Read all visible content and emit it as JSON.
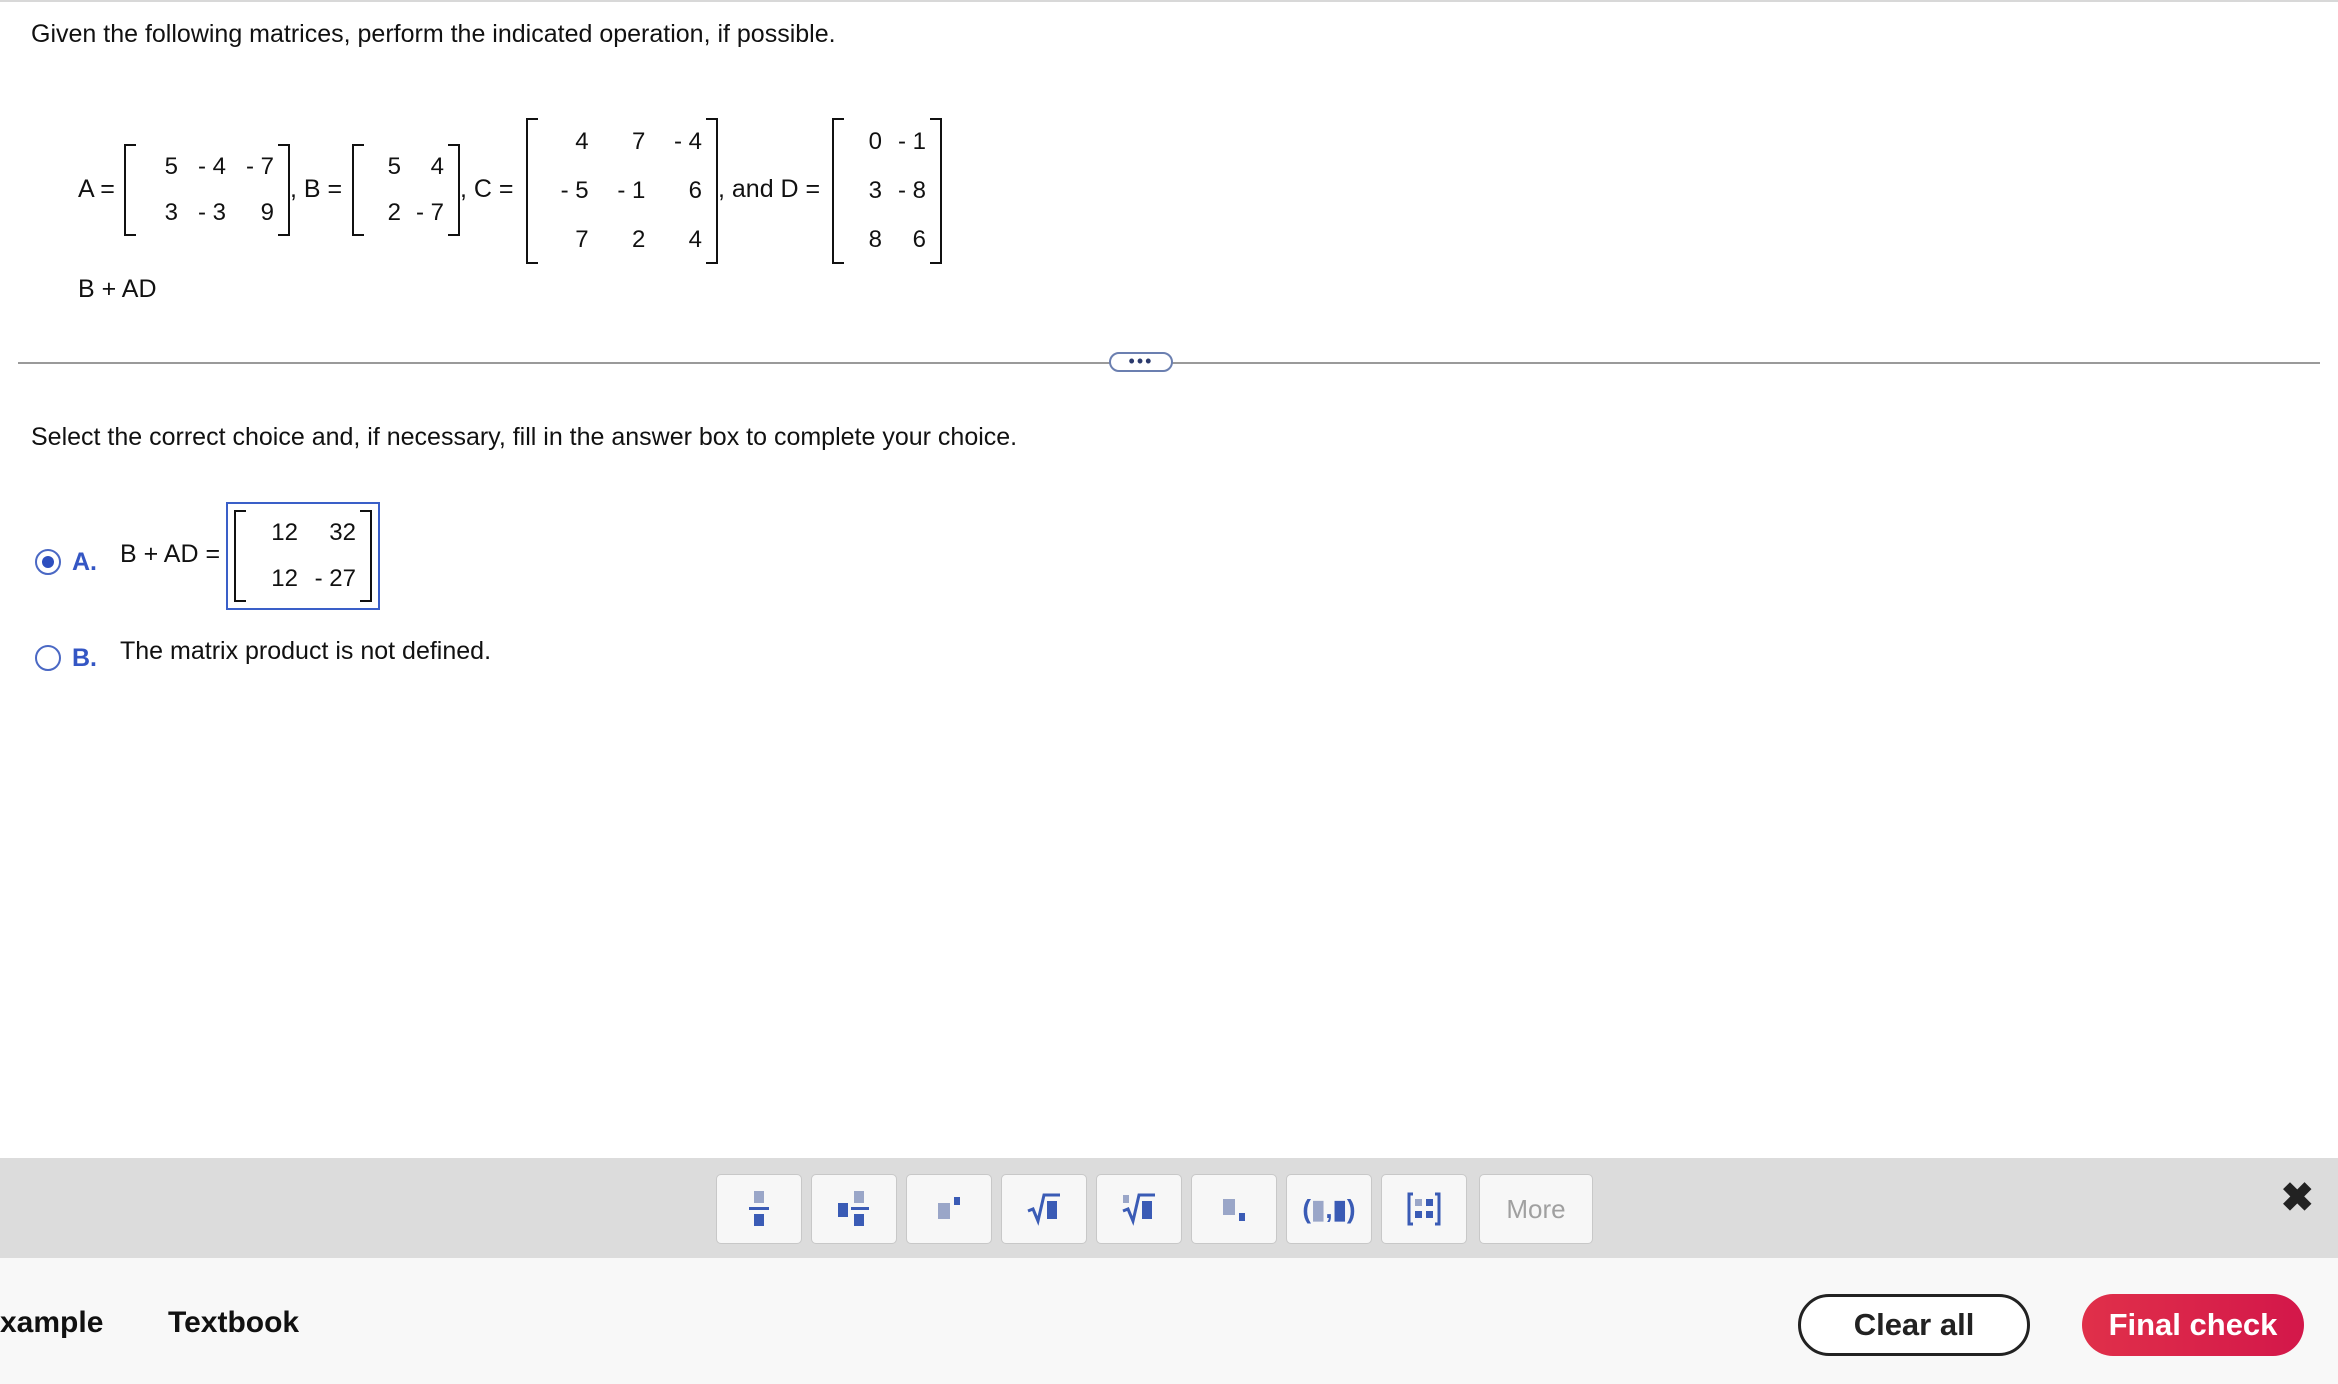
{
  "question": "Given the following matrices, perform the indicated operation, if possible.",
  "labels": {
    "a": "A =",
    "b": ", B =",
    "c": ", C =",
    "d": ", and D ="
  },
  "matrices": {
    "A": [
      [
        "5",
        "- 4",
        "- 7"
      ],
      [
        "3",
        "- 3",
        "9"
      ]
    ],
    "B": [
      [
        "5",
        "4"
      ],
      [
        "2",
        "- 7"
      ]
    ],
    "C": [
      [
        "4",
        "7",
        "- 4"
      ],
      [
        "- 5",
        "- 1",
        "6"
      ],
      [
        "7",
        "2",
        "4"
      ]
    ],
    "D": [
      [
        "0",
        "- 1"
      ],
      [
        "3",
        "- 8"
      ],
      [
        "8",
        "6"
      ]
    ]
  },
  "subtask": "B + AD",
  "instruction": "Select the correct choice and, if necessary, fill in the answer box to complete your choice.",
  "expander_label": "•••",
  "options": {
    "a": {
      "letter": "A.",
      "text": "B + AD =",
      "selected": true,
      "answer": [
        [
          "12",
          "32"
        ],
        [
          "12",
          "- 27"
        ]
      ]
    },
    "b": {
      "letter": "B.",
      "text": "The matrix product is not defined.",
      "selected": false
    }
  },
  "toolbar": {
    "buttons": [
      "fraction-icon",
      "mixed-number-icon",
      "exponent-icon",
      "square-root-icon",
      "nth-root-icon",
      "subscript-icon",
      "ordered-pair-icon",
      "matrix-icon"
    ],
    "more_label": "More",
    "close_label": "✖"
  },
  "footer": {
    "example_label": "xample",
    "textbook_label": "Textbook",
    "clear_label": "Clear all",
    "final_label": "Final check"
  },
  "colors": {
    "accent": "#3456c4",
    "final_button": "#d91f48"
  }
}
